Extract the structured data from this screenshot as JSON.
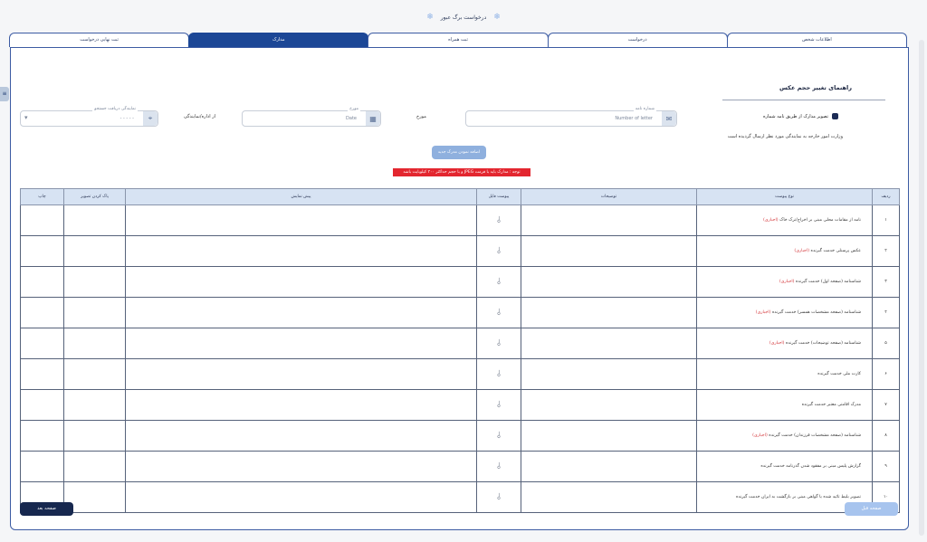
{
  "window": {
    "title": "درخواست برگ عبور"
  },
  "tabs": [
    {
      "label": "اطلاعات شخص"
    },
    {
      "label": "درخواست"
    },
    {
      "label": "ثبت همراه"
    },
    {
      "label": "مدارک",
      "active": true
    },
    {
      "label": "ثبت نهایی درخواست"
    }
  ],
  "guide": {
    "title": "راهنمای تغییر حجم عکس",
    "checkbox_label": "تصویر مدارک از طریق نامه شماره",
    "note": "وزارت امور خارجه به نمایندگی مورد نظر ارسال گردیده است"
  },
  "form": {
    "letter_number": {
      "label": "شماره نامه",
      "placeholder": "Number of letter"
    },
    "dated_label": "مورخ",
    "date": {
      "label": "مورخ",
      "placeholder": "Date"
    },
    "office_label": "از اداره/نمایندگی",
    "recipient": {
      "label": "نمایندگی دریافت جستجو",
      "value": "- - - - -"
    }
  },
  "buttons": {
    "add_doc": "اضافه نمودن مدرک جدید",
    "next": "صفحه بعد",
    "prev": "صفحه قبل"
  },
  "warning": "توجه : مدارک باید با فرمت JPEG و با حجم حداکثر ۳۰۰ کیلوبایت باشد",
  "table": {
    "headers": [
      "ردیف",
      "نوع پیوست",
      "توضیحات",
      "پیوست فایل",
      "پیش نمایش",
      "پاک کردن تصویر",
      "چاپ"
    ],
    "optional_label": "(اجباری)",
    "rows": [
      {
        "num": "۱",
        "type": "نامه از مقامات محلی مبنی بر اخراج/ترک خاک",
        "tag": "(اجباری)"
      },
      {
        "num": "۲",
        "type": "عکس پرسنلی خدمت گیرنده",
        "tag": "(اجباری)"
      },
      {
        "num": "۳",
        "type": "شناسنامه (صفحه اول) خدمت گیرنده",
        "tag": "(اجباری)"
      },
      {
        "num": "۴",
        "type": "شناسنامه (صفحه مشخصات همسر) خدمت گیرنده",
        "tag": "(اجباری)"
      },
      {
        "num": "۵",
        "type": "شناسنامه (صفحه توضیحات) خدمت گیرنده",
        "tag": "(اجباری)"
      },
      {
        "num": "۶",
        "type": "کارت ملی خدمت گیرنده",
        "tag": ""
      },
      {
        "num": "۷",
        "type": "مدرک اقامتی معتبر خدمت گیرنده",
        "tag": ""
      },
      {
        "num": "۸",
        "type": "شناسنامه (صفحه مشخصات فرزندان) خدمت گیرنده",
        "tag": "(اجباری)"
      },
      {
        "num": "۹",
        "type": "گزارش پلیس مبنی بر مفقود شدن گذرنامه خدمت گیرنده",
        "tag": ""
      },
      {
        "num": "۱۰",
        "type": "تصویر بلیط تائید شده یا گواهی مبنی بر بازگشت به ایران خدمت گیرنده",
        "tag": ""
      }
    ]
  },
  "colors": {
    "primary": "#1c4796",
    "danger": "#e3262f",
    "header": "#d7e3f3"
  }
}
